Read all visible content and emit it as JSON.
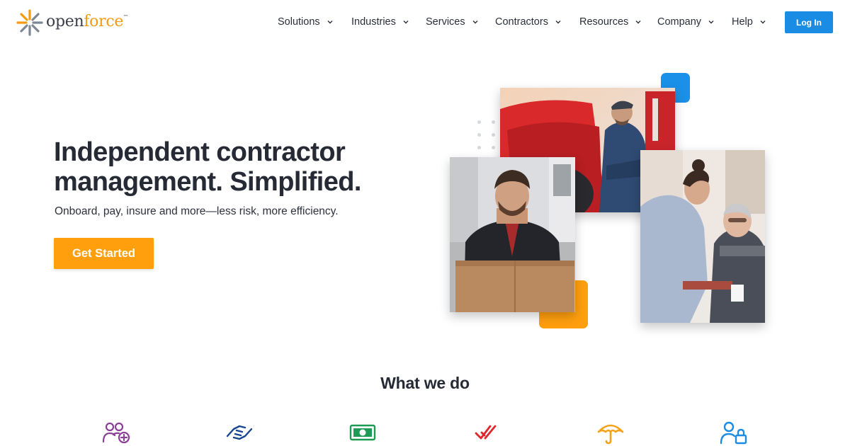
{
  "brand": {
    "name_part1": "open",
    "name_part2": "force",
    "trademark": "™",
    "colors": {
      "orange": "#ff9f0e",
      "blue": "#1b8ce3",
      "text": "#262a35"
    }
  },
  "nav": {
    "items": [
      {
        "label": "Solutions"
      },
      {
        "label": "Industries"
      },
      {
        "label": "Services"
      },
      {
        "label": "Contractors"
      },
      {
        "label": "Resources"
      },
      {
        "label": "Company"
      },
      {
        "label": "Help"
      }
    ],
    "login_label": "Log In"
  },
  "hero": {
    "title_line1": "Independent contractor",
    "title_line2": "management. Simplified.",
    "subtitle": "Onboard, pay, insure and more—less risk, more efficiency.",
    "cta_label": "Get Started"
  },
  "section": {
    "title": "What we do",
    "icons": [
      {
        "name": "add-users-icon",
        "color": "#8b3f98"
      },
      {
        "name": "handshake-icon",
        "color": "#17468f"
      },
      {
        "name": "money-bill-icon",
        "color": "#1d9a54"
      },
      {
        "name": "double-check-icon",
        "color": "#e0262d"
      },
      {
        "name": "umbrella-icon",
        "color": "#f5a21a"
      },
      {
        "name": "user-lock-icon",
        "color": "#1b8ce3"
      }
    ]
  }
}
